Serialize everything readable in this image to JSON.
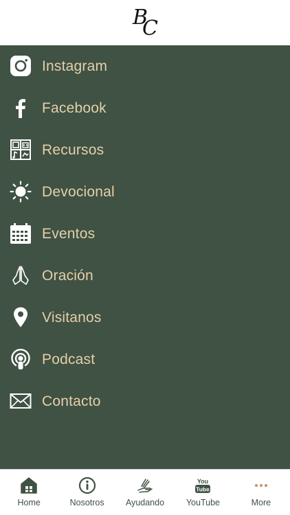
{
  "header": {
    "logo_top": "B",
    "logo_bottom": "C"
  },
  "menu": {
    "items": [
      {
        "label": "Instagram",
        "icon": "instagram-icon"
      },
      {
        "label": "Facebook",
        "icon": "facebook-icon"
      },
      {
        "label": "Recursos",
        "icon": "resources-grid-icon"
      },
      {
        "label": "Devocional",
        "icon": "sun-icon"
      },
      {
        "label": "Eventos",
        "icon": "calendar-icon"
      },
      {
        "label": "Oración",
        "icon": "praying-hands-icon"
      },
      {
        "label": "Visitanos",
        "icon": "map-pin-icon"
      },
      {
        "label": "Podcast",
        "icon": "podcast-icon"
      },
      {
        "label": "Contacto",
        "icon": "envelope-icon"
      }
    ]
  },
  "tabbar": {
    "tabs": [
      {
        "label": "Home",
        "icon": "home-icon"
      },
      {
        "label": "Nosotros",
        "icon": "info-icon"
      },
      {
        "label": "Ayudando",
        "icon": "helping-hands-icon"
      },
      {
        "label": "YouTube",
        "icon": "youtube-icon"
      },
      {
        "label": "More",
        "icon": "more-dots-icon"
      }
    ]
  },
  "colors": {
    "menu_bg": "#3f5244",
    "menu_text": "#e6cfa9",
    "icon": "#ffffff",
    "tab_text": "#3f5244",
    "more_dots": "#d0896a"
  }
}
